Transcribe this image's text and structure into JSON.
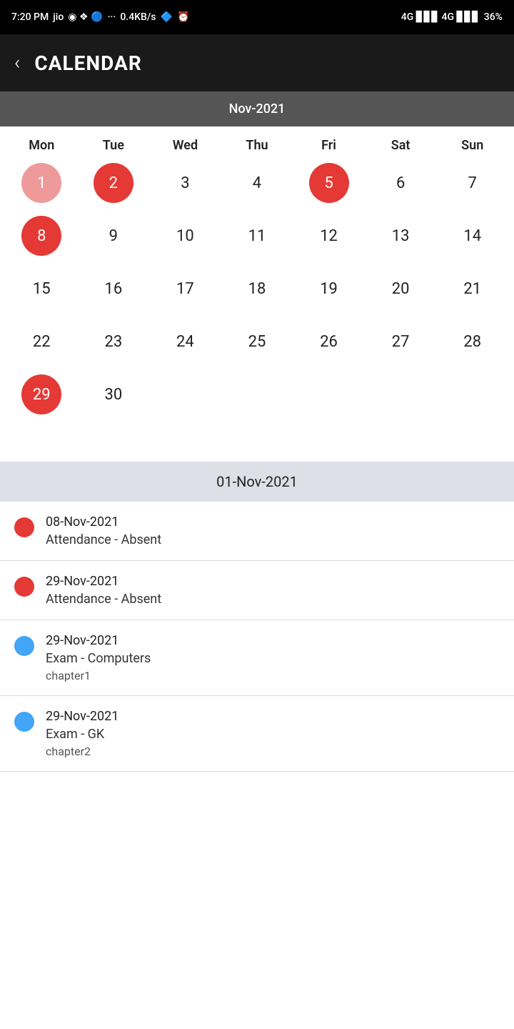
{
  "statusBar": {
    "time": "7:20 PM",
    "network": "0.4KB/s",
    "battery": "36%"
  },
  "header": {
    "title": "CALENDAR",
    "backLabel": "‹"
  },
  "calendar": {
    "monthLabel": "Nov-2021",
    "dayNames": [
      "Mon",
      "Tue",
      "Wed",
      "Thu",
      "Fri",
      "Sat",
      "Sun"
    ],
    "days": [
      {
        "num": "1",
        "type": "circle-red-light",
        "col": 1
      },
      {
        "num": "2",
        "type": "circle-red",
        "col": 2
      },
      {
        "num": "3",
        "type": "normal",
        "col": 3
      },
      {
        "num": "4",
        "type": "normal",
        "col": 4
      },
      {
        "num": "5",
        "type": "circle-red",
        "col": 5
      },
      {
        "num": "6",
        "type": "normal",
        "col": 6
      },
      {
        "num": "7",
        "type": "normal",
        "col": 7
      },
      {
        "num": "8",
        "type": "circle-red",
        "col": 1
      },
      {
        "num": "9",
        "type": "normal",
        "col": 2
      },
      {
        "num": "10",
        "type": "normal",
        "col": 3
      },
      {
        "num": "11",
        "type": "normal",
        "col": 4
      },
      {
        "num": "12",
        "type": "normal",
        "col": 5
      },
      {
        "num": "13",
        "type": "normal",
        "col": 6
      },
      {
        "num": "14",
        "type": "normal",
        "col": 7
      },
      {
        "num": "15",
        "type": "normal",
        "col": 1
      },
      {
        "num": "16",
        "type": "normal",
        "col": 2
      },
      {
        "num": "17",
        "type": "normal",
        "col": 3
      },
      {
        "num": "18",
        "type": "normal",
        "col": 4
      },
      {
        "num": "19",
        "type": "normal",
        "col": 5
      },
      {
        "num": "20",
        "type": "normal",
        "col": 6
      },
      {
        "num": "21",
        "type": "normal",
        "col": 7
      },
      {
        "num": "22",
        "type": "normal",
        "col": 1
      },
      {
        "num": "23",
        "type": "normal",
        "col": 2
      },
      {
        "num": "24",
        "type": "normal",
        "col": 3
      },
      {
        "num": "25",
        "type": "normal",
        "col": 4
      },
      {
        "num": "26",
        "type": "normal",
        "col": 5
      },
      {
        "num": "27",
        "type": "normal",
        "col": 6
      },
      {
        "num": "28",
        "type": "normal",
        "col": 7
      },
      {
        "num": "29",
        "type": "circle-red",
        "col": 1
      },
      {
        "num": "30",
        "type": "normal",
        "col": 2
      }
    ]
  },
  "events": {
    "headerDate": "01-Nov-2021",
    "items": [
      {
        "dotColor": "red",
        "date": "08-Nov-2021",
        "title": "Attendance - Absent",
        "sub": ""
      },
      {
        "dotColor": "red",
        "date": "29-Nov-2021",
        "title": "Attendance - Absent",
        "sub": ""
      },
      {
        "dotColor": "blue",
        "date": "29-Nov-2021",
        "title": "Exam - Computers",
        "sub": "chapter1"
      },
      {
        "dotColor": "blue",
        "date": "29-Nov-2021",
        "title": "Exam - GK",
        "sub": "chapter2"
      }
    ]
  }
}
